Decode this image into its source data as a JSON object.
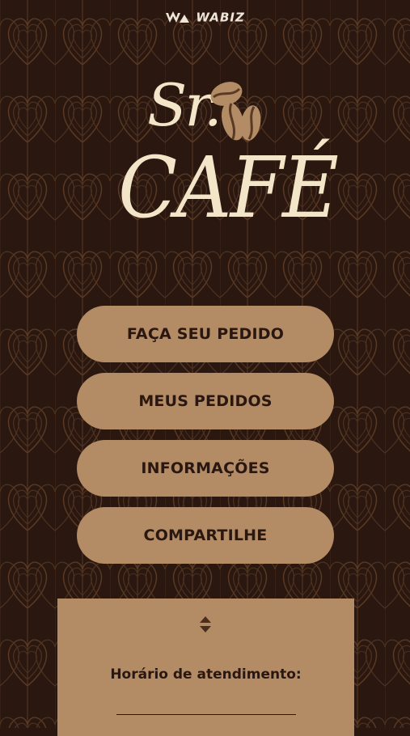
{
  "header": {
    "provider_logo": "WABIZ"
  },
  "brand": {
    "line1": "Sr.",
    "line2": "CAFÉ",
    "icon": "coffee-beans-icon"
  },
  "menu": {
    "items": [
      {
        "label": "FAÇA SEU PEDIDO"
      },
      {
        "label": "MEUS PEDIDOS"
      },
      {
        "label": "INFORMAÇÕES"
      },
      {
        "label": "COMPARTILHE"
      }
    ]
  },
  "info": {
    "toggle_icon": "expand-collapse-icon",
    "hours_title": "Horário de atendimento:"
  },
  "colors": {
    "background": "#2a1710",
    "pattern": "#5a3a24",
    "button": "#b38b65",
    "button_text": "#2a1710",
    "logo_cream": "#f3e5c8"
  }
}
